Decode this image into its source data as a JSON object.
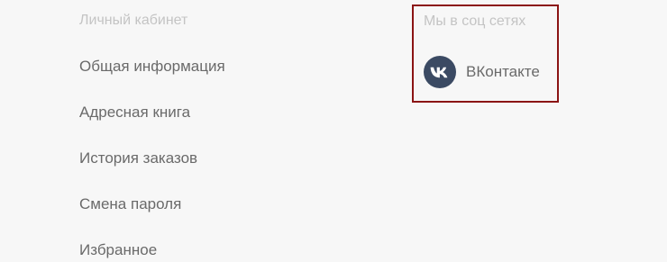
{
  "account": {
    "heading": "Личный кабинет",
    "links": [
      {
        "label": "Общая информация"
      },
      {
        "label": "Адресная книга"
      },
      {
        "label": "История заказов"
      },
      {
        "label": "Смена пароля"
      },
      {
        "label": "Избранное"
      }
    ]
  },
  "social": {
    "heading": "Мы в соц сетях",
    "links": [
      {
        "label": "ВКонтакте",
        "icon": "vk-icon"
      }
    ]
  },
  "colors": {
    "background": "#f7f7f7",
    "heading_text": "#c4c4c4",
    "link_text": "#6a6a6a",
    "highlight_border": "#8b1414",
    "vk_circle": "#3b4a63"
  }
}
